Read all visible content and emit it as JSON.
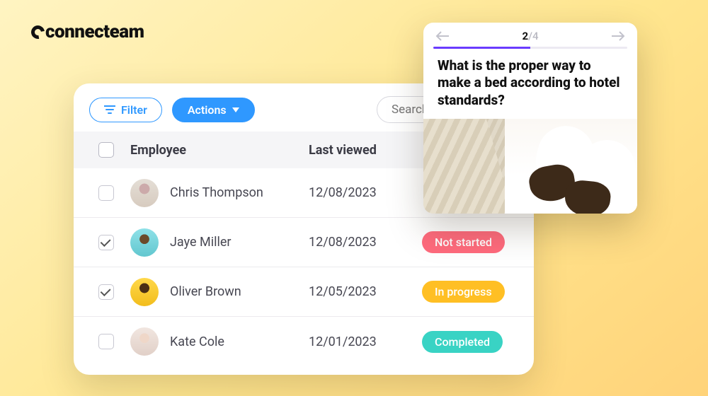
{
  "brand": "connecteam",
  "toolbar": {
    "filter_label": "Filter",
    "actions_label": "Actions",
    "search_placeholder": "Search"
  },
  "table": {
    "headers": {
      "employee": "Employee",
      "last_viewed": "Last viewed"
    },
    "rows": [
      {
        "checked": false,
        "name": "Chris Thompson",
        "date": "12/08/2023",
        "status": null
      },
      {
        "checked": true,
        "name": "Jaye Miller",
        "date": "12/08/2023",
        "status": "Not started",
        "status_class": "ns"
      },
      {
        "checked": true,
        "name": "Oliver Brown",
        "date": "12/05/2023",
        "status": "In progress",
        "status_class": "ip"
      },
      {
        "checked": false,
        "name": "Kate Cole",
        "date": "12/01/2023",
        "status": "Completed",
        "status_class": "cp"
      }
    ]
  },
  "quiz": {
    "current": "2",
    "total": "/4",
    "progress_pct": 50,
    "question": "What is the proper way to make a bed according to hotel standards?"
  }
}
